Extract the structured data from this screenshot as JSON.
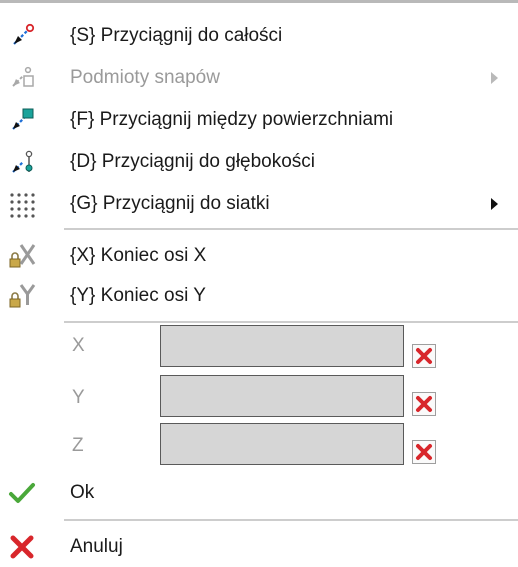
{
  "menu": {
    "items": [
      {
        "label": "{S} Przyciągnij do całości",
        "icon": "snap-whole-icon"
      },
      {
        "label": "Podmioty snapów",
        "icon": "snap-subjects-icon",
        "disabled": true,
        "submenu": true
      },
      {
        "label": "{F} Przyciągnij między powierzchniami",
        "icon": "snap-between-surfaces-icon"
      },
      {
        "label": "{D} Przyciągnij do głębokości",
        "icon": "snap-depth-icon"
      },
      {
        "label": "{G} Przyciągnij do siatki",
        "icon": "snap-grid-icon",
        "submenu": true
      }
    ],
    "axis_items": [
      {
        "label": "{X} Koniec osi X",
        "icon": "lock-x-icon"
      },
      {
        "label": "{Y} Koniec osi Y",
        "icon": "lock-y-icon"
      }
    ],
    "fields": [
      {
        "label": "X",
        "value": ""
      },
      {
        "label": "Y",
        "value": ""
      },
      {
        "label": "Z",
        "value": ""
      }
    ],
    "ok_label": "Ok",
    "cancel_label": "Anuluj"
  },
  "colors": {
    "accent_blue": "#1f6fd6",
    "accent_teal": "#1aa39b",
    "clear_red": "#d8262b",
    "ok_green": "#4aa83a",
    "cancel_red": "#d8262b"
  }
}
